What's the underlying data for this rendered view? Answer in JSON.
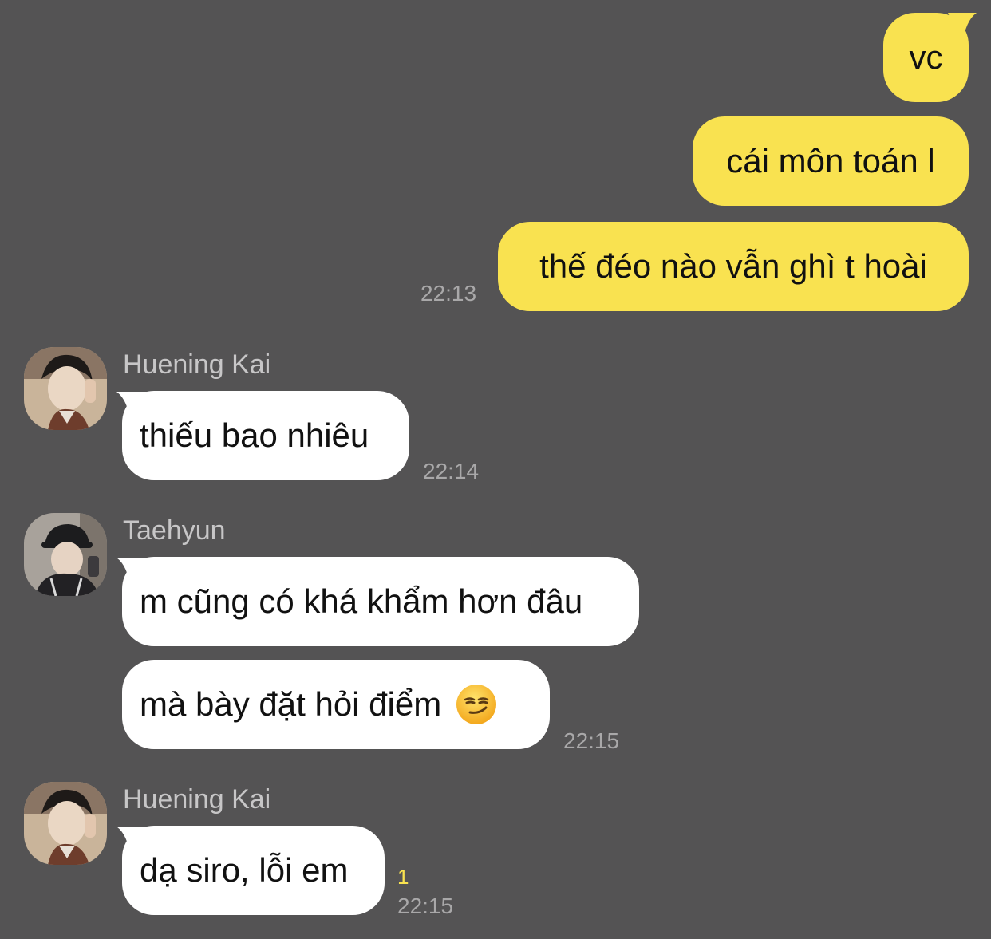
{
  "messages_out": [
    {
      "text": "vc"
    },
    {
      "text": "cái môn toán l"
    },
    {
      "text": "thế đéo nào vẫn ghì t hoài",
      "time": "22:13"
    }
  ],
  "group1": {
    "sender": "Huening Kai",
    "messages": [
      {
        "text": "thiếu bao nhiêu",
        "time": "22:14"
      }
    ]
  },
  "group2": {
    "sender": "Taehyun",
    "messages": [
      {
        "text": "m cũng có khá khẩm hơn đâu"
      },
      {
        "text": "mà bày đặt hỏi điểm",
        "emoji": "smirking-face-emoji",
        "time": "22:15"
      }
    ]
  },
  "group3": {
    "sender": "Huening Kai",
    "messages": [
      {
        "text": "dạ siro, lỗi em",
        "unread": "1",
        "time": "22:15"
      }
    ]
  },
  "colors": {
    "background": "#545354",
    "outgoing_bubble": "#f9e250",
    "incoming_bubble": "#ffffff",
    "timestamp": "#a9a8a9",
    "unread_count": "#f9e250"
  }
}
